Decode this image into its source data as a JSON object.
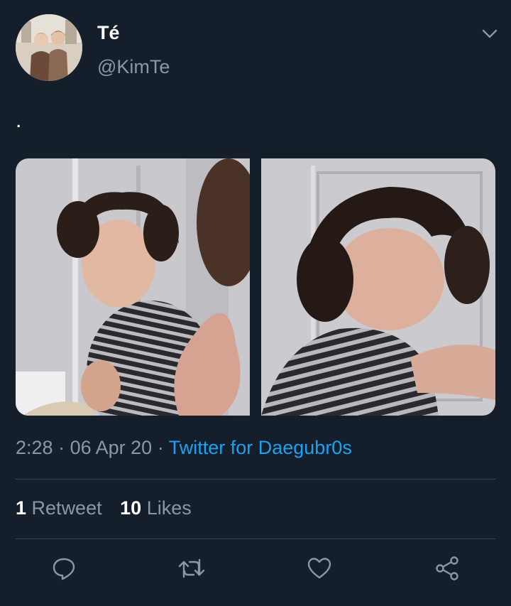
{
  "tweet": {
    "display_name": "Té",
    "handle": "@KimTe",
    "text": ".",
    "time": "2:28",
    "date": "06 Apr 20",
    "separator": "·",
    "source": "Twitter for Daegubr0s"
  },
  "stats": {
    "retweets_count": "1",
    "retweets_label": "Retweet",
    "likes_count": "10",
    "likes_label": "Likes"
  },
  "actions": [
    "reply-icon",
    "retweet-icon",
    "like-icon",
    "share-icon"
  ],
  "colors": {
    "background": "#151f2b",
    "text": "#ffffff",
    "muted": "#8899a6",
    "link": "#1da1f2",
    "divider": "#38444d"
  }
}
